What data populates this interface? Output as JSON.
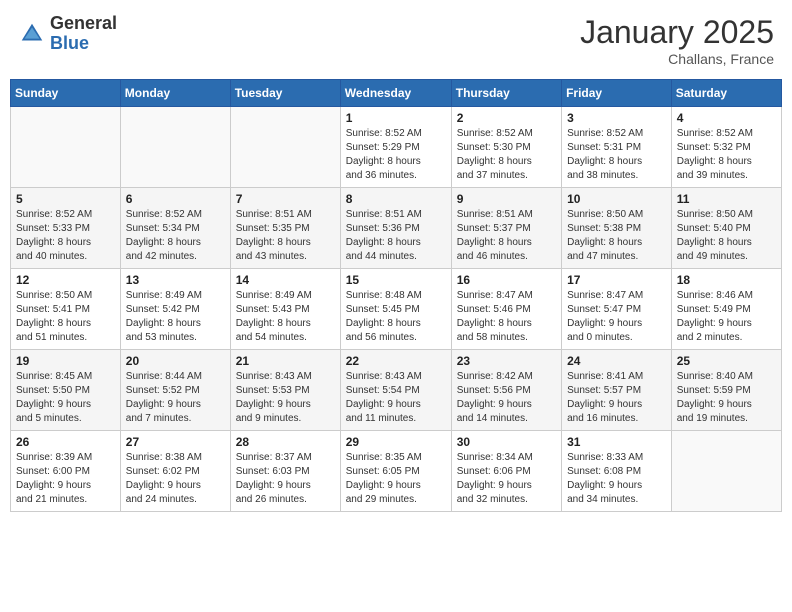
{
  "header": {
    "logo_general": "General",
    "logo_blue": "Blue",
    "month_title": "January 2025",
    "location": "Challans, France"
  },
  "weekdays": [
    "Sunday",
    "Monday",
    "Tuesday",
    "Wednesday",
    "Thursday",
    "Friday",
    "Saturday"
  ],
  "weeks": [
    [
      {
        "day": "",
        "info": ""
      },
      {
        "day": "",
        "info": ""
      },
      {
        "day": "",
        "info": ""
      },
      {
        "day": "1",
        "info": "Sunrise: 8:52 AM\nSunset: 5:29 PM\nDaylight: 8 hours\nand 36 minutes."
      },
      {
        "day": "2",
        "info": "Sunrise: 8:52 AM\nSunset: 5:30 PM\nDaylight: 8 hours\nand 37 minutes."
      },
      {
        "day": "3",
        "info": "Sunrise: 8:52 AM\nSunset: 5:31 PM\nDaylight: 8 hours\nand 38 minutes."
      },
      {
        "day": "4",
        "info": "Sunrise: 8:52 AM\nSunset: 5:32 PM\nDaylight: 8 hours\nand 39 minutes."
      }
    ],
    [
      {
        "day": "5",
        "info": "Sunrise: 8:52 AM\nSunset: 5:33 PM\nDaylight: 8 hours\nand 40 minutes."
      },
      {
        "day": "6",
        "info": "Sunrise: 8:52 AM\nSunset: 5:34 PM\nDaylight: 8 hours\nand 42 minutes."
      },
      {
        "day": "7",
        "info": "Sunrise: 8:51 AM\nSunset: 5:35 PM\nDaylight: 8 hours\nand 43 minutes."
      },
      {
        "day": "8",
        "info": "Sunrise: 8:51 AM\nSunset: 5:36 PM\nDaylight: 8 hours\nand 44 minutes."
      },
      {
        "day": "9",
        "info": "Sunrise: 8:51 AM\nSunset: 5:37 PM\nDaylight: 8 hours\nand 46 minutes."
      },
      {
        "day": "10",
        "info": "Sunrise: 8:50 AM\nSunset: 5:38 PM\nDaylight: 8 hours\nand 47 minutes."
      },
      {
        "day": "11",
        "info": "Sunrise: 8:50 AM\nSunset: 5:40 PM\nDaylight: 8 hours\nand 49 minutes."
      }
    ],
    [
      {
        "day": "12",
        "info": "Sunrise: 8:50 AM\nSunset: 5:41 PM\nDaylight: 8 hours\nand 51 minutes."
      },
      {
        "day": "13",
        "info": "Sunrise: 8:49 AM\nSunset: 5:42 PM\nDaylight: 8 hours\nand 53 minutes."
      },
      {
        "day": "14",
        "info": "Sunrise: 8:49 AM\nSunset: 5:43 PM\nDaylight: 8 hours\nand 54 minutes."
      },
      {
        "day": "15",
        "info": "Sunrise: 8:48 AM\nSunset: 5:45 PM\nDaylight: 8 hours\nand 56 minutes."
      },
      {
        "day": "16",
        "info": "Sunrise: 8:47 AM\nSunset: 5:46 PM\nDaylight: 8 hours\nand 58 minutes."
      },
      {
        "day": "17",
        "info": "Sunrise: 8:47 AM\nSunset: 5:47 PM\nDaylight: 9 hours\nand 0 minutes."
      },
      {
        "day": "18",
        "info": "Sunrise: 8:46 AM\nSunset: 5:49 PM\nDaylight: 9 hours\nand 2 minutes."
      }
    ],
    [
      {
        "day": "19",
        "info": "Sunrise: 8:45 AM\nSunset: 5:50 PM\nDaylight: 9 hours\nand 5 minutes."
      },
      {
        "day": "20",
        "info": "Sunrise: 8:44 AM\nSunset: 5:52 PM\nDaylight: 9 hours\nand 7 minutes."
      },
      {
        "day": "21",
        "info": "Sunrise: 8:43 AM\nSunset: 5:53 PM\nDaylight: 9 hours\nand 9 minutes."
      },
      {
        "day": "22",
        "info": "Sunrise: 8:43 AM\nSunset: 5:54 PM\nDaylight: 9 hours\nand 11 minutes."
      },
      {
        "day": "23",
        "info": "Sunrise: 8:42 AM\nSunset: 5:56 PM\nDaylight: 9 hours\nand 14 minutes."
      },
      {
        "day": "24",
        "info": "Sunrise: 8:41 AM\nSunset: 5:57 PM\nDaylight: 9 hours\nand 16 minutes."
      },
      {
        "day": "25",
        "info": "Sunrise: 8:40 AM\nSunset: 5:59 PM\nDaylight: 9 hours\nand 19 minutes."
      }
    ],
    [
      {
        "day": "26",
        "info": "Sunrise: 8:39 AM\nSunset: 6:00 PM\nDaylight: 9 hours\nand 21 minutes."
      },
      {
        "day": "27",
        "info": "Sunrise: 8:38 AM\nSunset: 6:02 PM\nDaylight: 9 hours\nand 24 minutes."
      },
      {
        "day": "28",
        "info": "Sunrise: 8:37 AM\nSunset: 6:03 PM\nDaylight: 9 hours\nand 26 minutes."
      },
      {
        "day": "29",
        "info": "Sunrise: 8:35 AM\nSunset: 6:05 PM\nDaylight: 9 hours\nand 29 minutes."
      },
      {
        "day": "30",
        "info": "Sunrise: 8:34 AM\nSunset: 6:06 PM\nDaylight: 9 hours\nand 32 minutes."
      },
      {
        "day": "31",
        "info": "Sunrise: 8:33 AM\nSunset: 6:08 PM\nDaylight: 9 hours\nand 34 minutes."
      },
      {
        "day": "",
        "info": ""
      }
    ]
  ]
}
